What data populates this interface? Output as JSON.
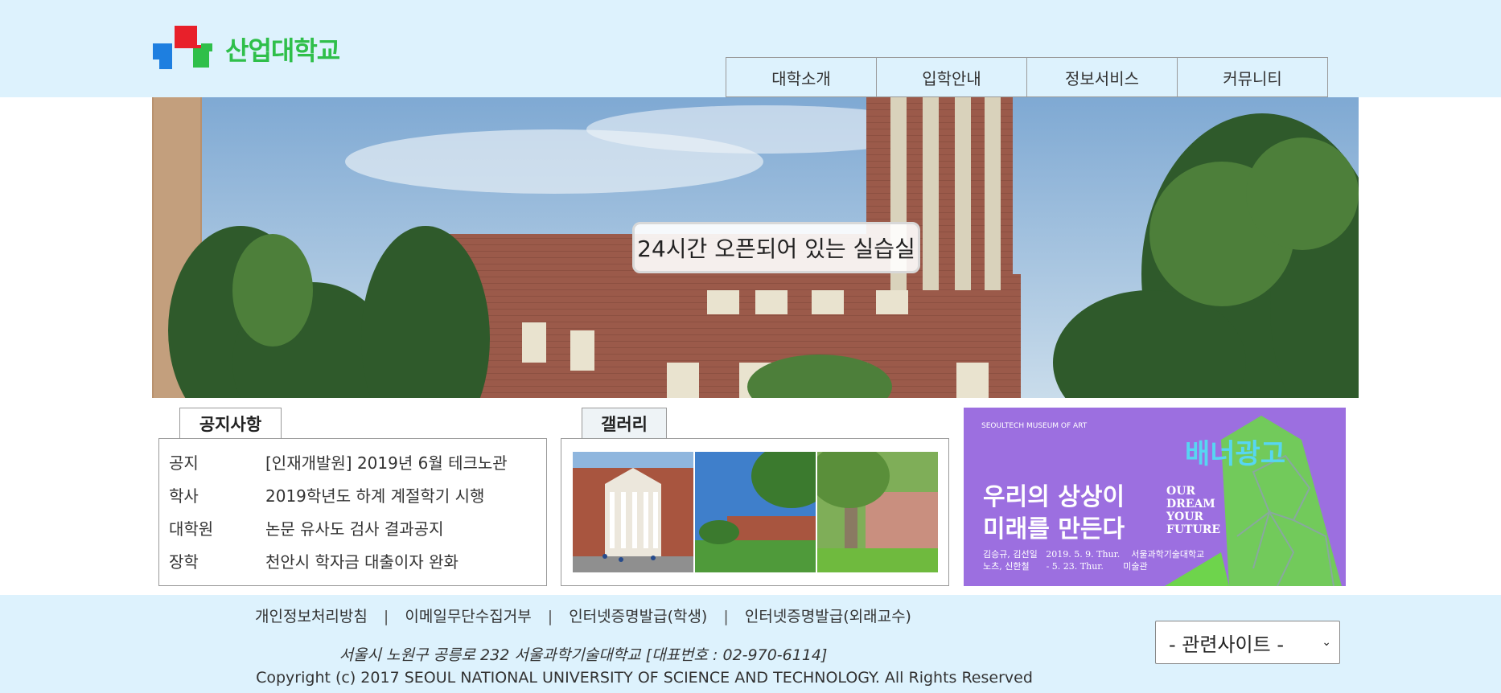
{
  "brand": {
    "name": "산업대학교"
  },
  "nav": {
    "items": [
      "대학소개",
      "입학안내",
      "정보서비스",
      "커뮤니티"
    ]
  },
  "hero": {
    "caption": "24시간 오픈되어 있는 실습실"
  },
  "notice": {
    "tab_label": "공지사항",
    "rows": [
      {
        "category": "공지",
        "title": "[인재개발원] 2019년 6월 테크노관"
      },
      {
        "category": "학사",
        "title": "2019학년도 하계 계절학기 시행"
      },
      {
        "category": "대학원",
        "title": "논문 유사도 검사 결과공지"
      },
      {
        "category": "장학",
        "title": "천안시 학자금 대출이자 완화"
      }
    ]
  },
  "gallery": {
    "tab_label": "갤러리"
  },
  "banner": {
    "label": "배너광고",
    "museum": "SEOULTECH MUSEUM OF ART",
    "headline_line1": "우리의 상상이",
    "headline_line2": "미래를 만든다",
    "english": [
      "OUR",
      "DREAM",
      "YOUR",
      "FUTURE"
    ],
    "details": "김승규, 김선일   2019. 5. 9. Thur.    서울과학기술대학교\n노츠, 신한철      - 5. 23. Thur.       미술관"
  },
  "footer": {
    "links": [
      "개인정보처리방침",
      "이메일무단수집거부",
      "인터넷증명발급(학생)",
      "인터넷증명발급(외래교수)"
    ],
    "separator": "|",
    "address": "서울시 노원구 공릉로 232 서울과학기술대학교 [대표번호 : 02-970-6114]",
    "copyright": "Copyright (c) 2017 SEOUL NATIONAL UNIVERSITY OF SCIENCE AND TECHNOLOGY. All Rights Reserved",
    "related_select": "- 관련사이트 -"
  },
  "colors": {
    "header_bg": "#ddf2fd",
    "logo_green": "#2fbf4a",
    "logo_red": "#e8202a",
    "logo_blue": "#1e7fe0",
    "banner_purple": "#9c6fe0"
  }
}
